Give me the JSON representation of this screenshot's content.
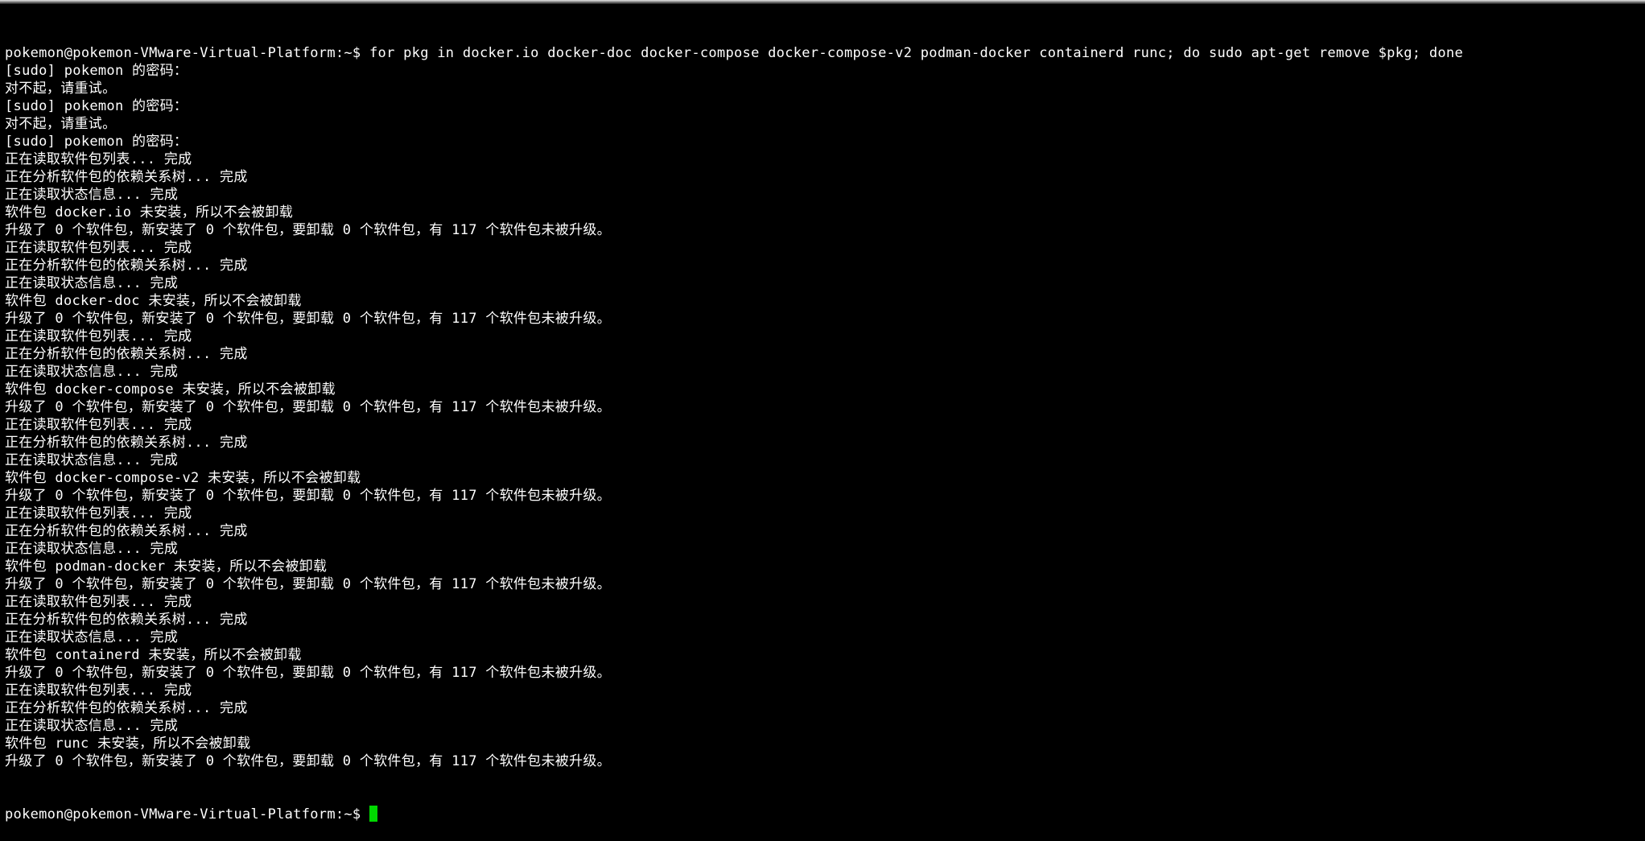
{
  "terminal": {
    "prompt": "pokemon@pokemon-VMware-Virtual-Platform:~$ ",
    "cursor_color": "#00d800",
    "lines": [
      "pokemon@pokemon-VMware-Virtual-Platform:~$ for pkg in docker.io docker-doc docker-compose docker-compose-v2 podman-docker containerd runc; do sudo apt-get remove $pkg; done",
      "[sudo] pokemon 的密码：",
      "对不起，请重试。",
      "[sudo] pokemon 的密码：",
      "对不起，请重试。",
      "[sudo] pokemon 的密码：",
      "正在读取软件包列表... 完成",
      "正在分析软件包的依赖关系树... 完成",
      "正在读取状态信息... 完成",
      "软件包 docker.io 未安装，所以不会被卸载",
      "升级了 0 个软件包，新安装了 0 个软件包，要卸载 0 个软件包，有 117 个软件包未被升级。",
      "正在读取软件包列表... 完成",
      "正在分析软件包的依赖关系树... 完成",
      "正在读取状态信息... 完成",
      "软件包 docker-doc 未安装，所以不会被卸载",
      "升级了 0 个软件包，新安装了 0 个软件包，要卸载 0 个软件包，有 117 个软件包未被升级。",
      "正在读取软件包列表... 完成",
      "正在分析软件包的依赖关系树... 完成",
      "正在读取状态信息... 完成",
      "软件包 docker-compose 未安装，所以不会被卸载",
      "升级了 0 个软件包，新安装了 0 个软件包，要卸载 0 个软件包，有 117 个软件包未被升级。",
      "正在读取软件包列表... 完成",
      "正在分析软件包的依赖关系树... 完成",
      "正在读取状态信息... 完成",
      "软件包 docker-compose-v2 未安装，所以不会被卸载",
      "升级了 0 个软件包，新安装了 0 个软件包，要卸载 0 个软件包，有 117 个软件包未被升级。",
      "正在读取软件包列表... 完成",
      "正在分析软件包的依赖关系树... 完成",
      "正在读取状态信息... 完成",
      "软件包 podman-docker 未安装，所以不会被卸载",
      "升级了 0 个软件包，新安装了 0 个软件包，要卸载 0 个软件包，有 117 个软件包未被升级。",
      "正在读取软件包列表... 完成",
      "正在分析软件包的依赖关系树... 完成",
      "正在读取状态信息... 完成",
      "软件包 containerd 未安装，所以不会被卸载",
      "升级了 0 个软件包，新安装了 0 个软件包，要卸载 0 个软件包，有 117 个软件包未被升级。",
      "正在读取软件包列表... 完成",
      "正在分析软件包的依赖关系树... 完成",
      "正在读取状态信息... 完成",
      "软件包 runc 未安装，所以不会被卸载",
      "升级了 0 个软件包，新安装了 0 个软件包，要卸载 0 个软件包，有 117 个软件包未被升级。"
    ]
  }
}
